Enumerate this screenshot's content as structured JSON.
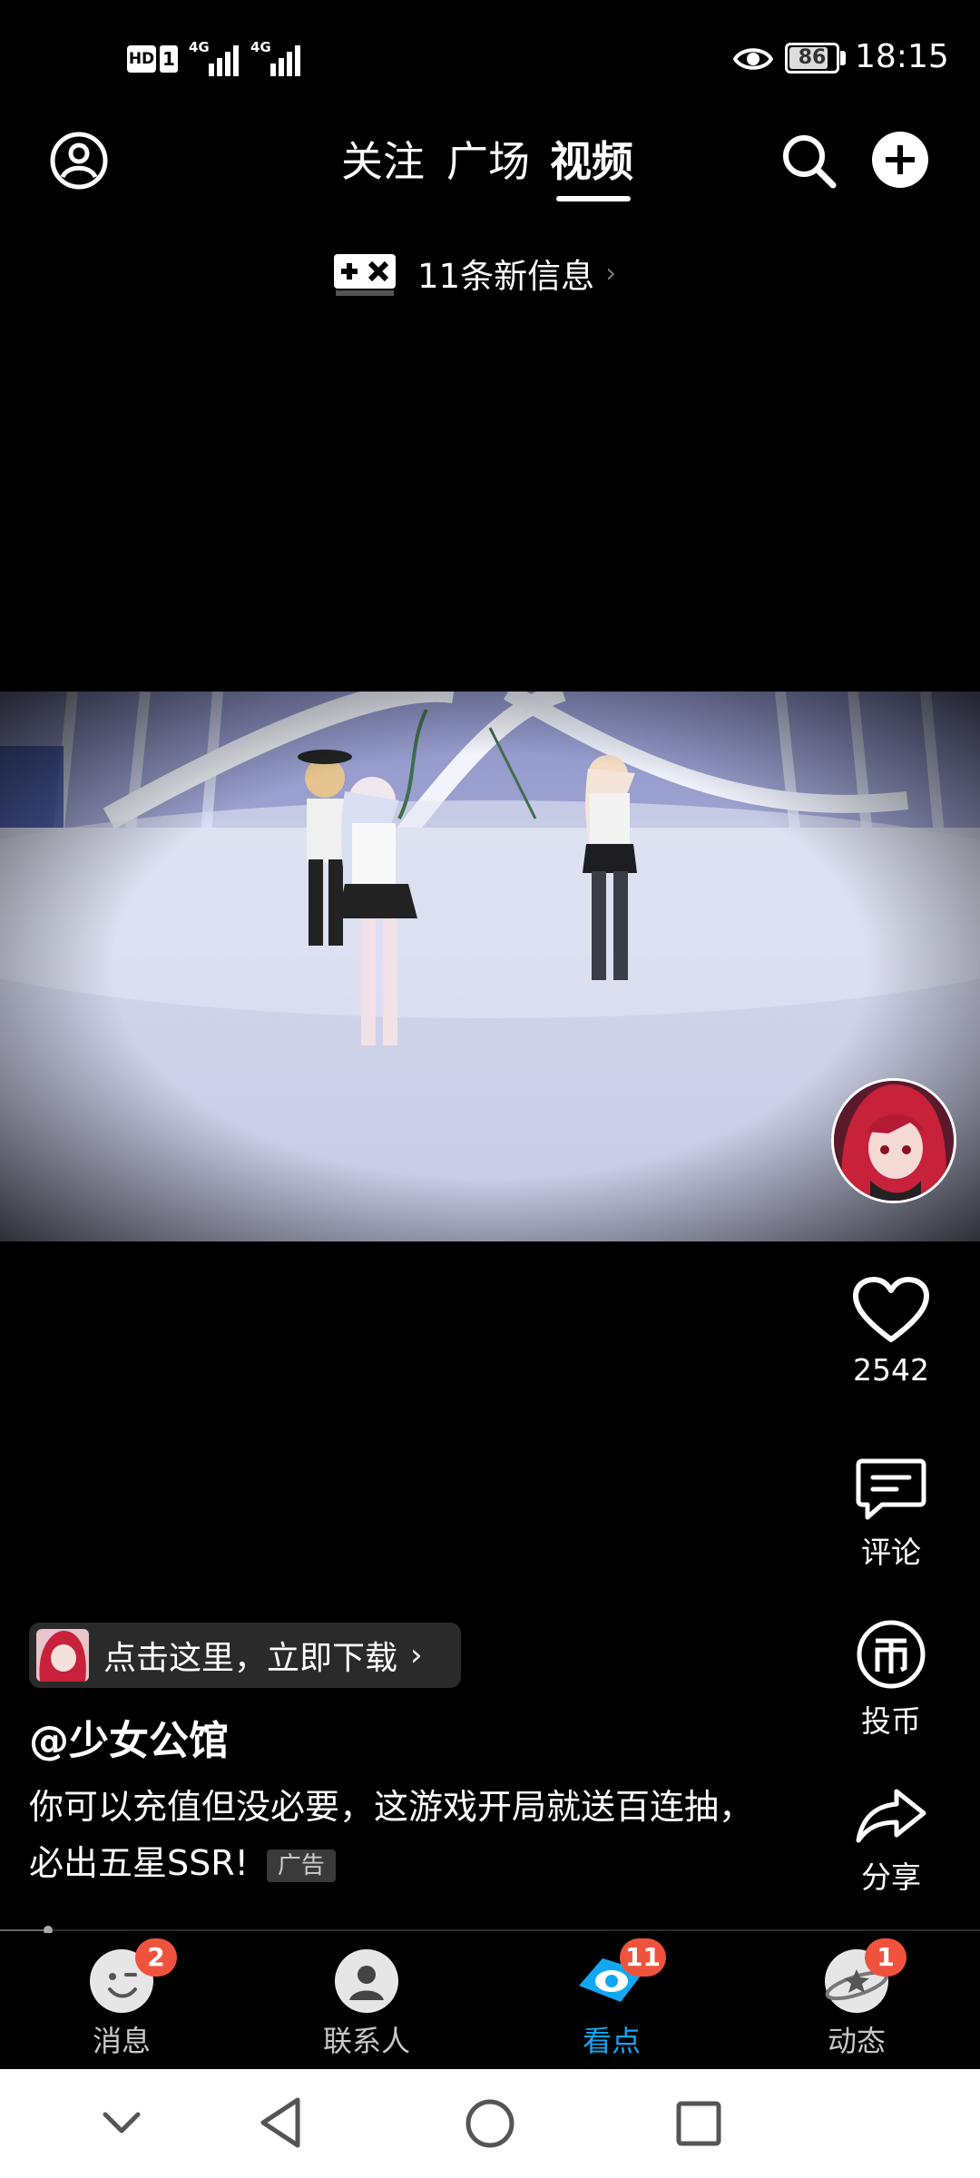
{
  "status_bar": {
    "left_icons": [
      "hd-icon",
      "sim1-icon",
      "signal-4g-icon",
      "signal-4g-icon"
    ],
    "hd_label": "HD",
    "sim_label": "1",
    "network_label_1": "4G",
    "network_label_2": "4G",
    "battery": "86",
    "time": "18:15"
  },
  "header": {
    "tabs": [
      {
        "label": "关注"
      },
      {
        "label": "广场"
      },
      {
        "label": "视频",
        "active": true
      }
    ]
  },
  "notice": {
    "text": "11条新信息"
  },
  "actions": {
    "like_count": "2542",
    "comment_label": "评论",
    "coin_label": "投币",
    "share_label": "分享"
  },
  "info": {
    "download_label": "点击这里，立即下载",
    "author": "@少女公馆",
    "caption": "你可以充值但没必要，这游戏开局就送百连抽，必出五星SSR!",
    "ad_label": "广告"
  },
  "bottom_nav": {
    "items": [
      {
        "label": "消息",
        "badge": "2"
      },
      {
        "label": "联系人",
        "badge": ""
      },
      {
        "label": "看点",
        "badge": "11",
        "active": true
      },
      {
        "label": "动态",
        "badge": "1"
      }
    ]
  },
  "colors": {
    "accent": "#12a7f5",
    "badge": "#f0533d"
  }
}
